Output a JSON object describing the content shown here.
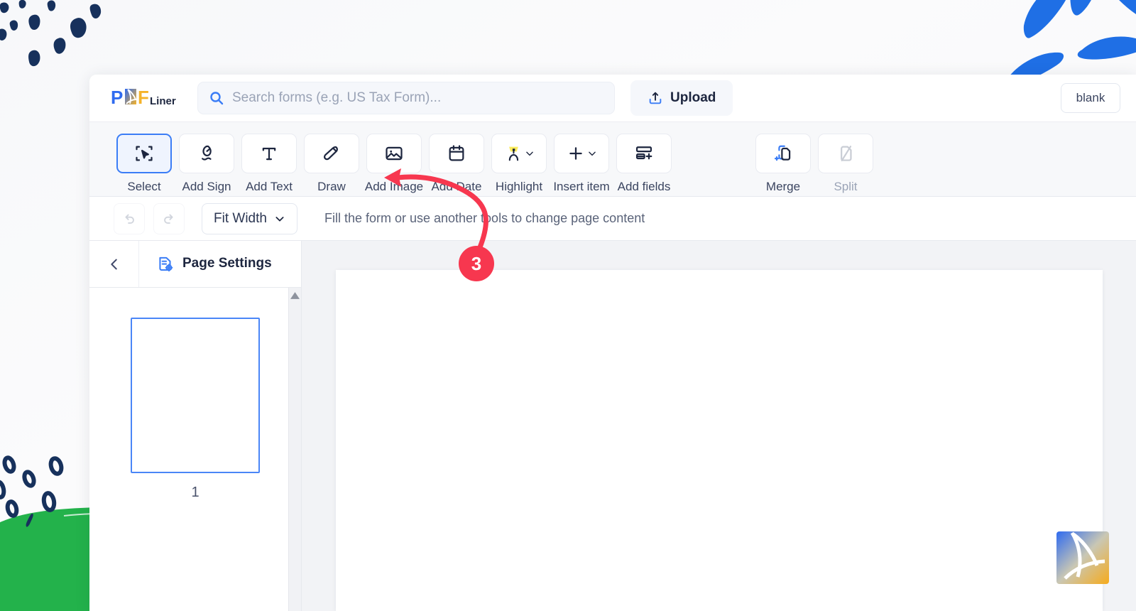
{
  "brand": {
    "name": "PDFLiner",
    "logo_text_p": "P",
    "logo_text_f": "F",
    "logo_text_liner": "Liner",
    "color_blue": "#2f6bf0",
    "color_yellow": "#f5b32a"
  },
  "header": {
    "search": {
      "placeholder": "Search forms (e.g. US Tax Form)...",
      "value": "",
      "icon": "search-icon"
    },
    "upload": {
      "label": "Upload",
      "icon": "upload-icon"
    },
    "document_name": "blank"
  },
  "toolbar": {
    "tools": [
      {
        "label": "Select",
        "icon": "cursor-select-icon",
        "active": true,
        "disabled": false,
        "caret": false
      },
      {
        "label": "Add Sign",
        "icon": "signature-pen-icon",
        "active": false,
        "disabled": false,
        "caret": false
      },
      {
        "label": "Add Text",
        "icon": "text-t-icon",
        "active": false,
        "disabled": false,
        "caret": false
      },
      {
        "label": "Draw",
        "icon": "brush-draw-icon",
        "active": false,
        "disabled": false,
        "caret": false
      },
      {
        "label": "Add Image",
        "icon": "image-picture-icon",
        "active": false,
        "disabled": false,
        "caret": false
      },
      {
        "label": "Add Date",
        "icon": "calendar-date-icon",
        "active": false,
        "disabled": false,
        "caret": false
      },
      {
        "label": "Highlight",
        "icon": "highlighter-icon",
        "active": false,
        "disabled": false,
        "caret": true
      },
      {
        "label": "Insert item",
        "icon": "plus-icon",
        "active": false,
        "disabled": false,
        "caret": true
      },
      {
        "label": "Add fields",
        "icon": "form-fields-icon",
        "active": false,
        "disabled": false,
        "caret": false
      }
    ],
    "tools_right": [
      {
        "label": "Merge",
        "icon": "merge-pages-icon",
        "active": false,
        "disabled": false,
        "caret": false
      },
      {
        "label": "Split",
        "icon": "split-page-icon",
        "active": false,
        "disabled": true,
        "caret": false
      }
    ]
  },
  "view_bar": {
    "undo": {
      "icon": "undo-icon",
      "disabled": true
    },
    "redo": {
      "icon": "redo-icon",
      "disabled": true
    },
    "zoom_value": "Fit Width",
    "zoom_caret": "chevron-down-icon",
    "hint": "Fill the form or use another tools to change page content"
  },
  "sidebar": {
    "collapse_icon": "chevron-left-icon",
    "tab": {
      "label": "Page Settings",
      "icon": "page-settings-icon"
    },
    "pages": [
      {
        "number": "1"
      }
    ]
  },
  "annotation": {
    "step_number": "3",
    "accent_color": "#f7374f",
    "points_to": "Draw"
  },
  "watermark": {
    "name": "pdfliner-badge"
  },
  "decor": {
    "confetti_color": "#17315c",
    "leaf_color": "#1f6fe5",
    "hill_color": "#23b24b"
  }
}
